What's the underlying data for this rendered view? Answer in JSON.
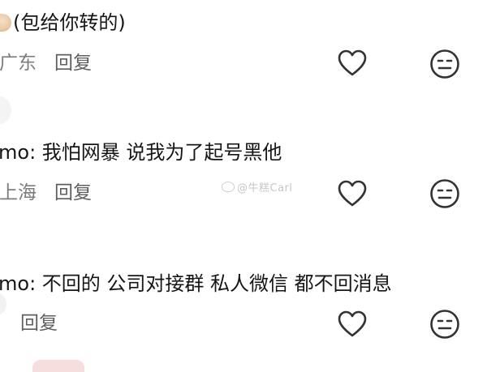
{
  "comments": [
    {
      "text": "(包给你转的)",
      "location": "广东",
      "reply_label": "回复"
    },
    {
      "text": "mo: 我怕网暴 说我为了起号黑他",
      "location": "上海",
      "reply_label": "回复"
    },
    {
      "text": "mo: 不回的 公司对接群 私人微信 都不回消息",
      "location": "",
      "reply_label": "回复"
    }
  ],
  "watermark": "@牛糕Carl",
  "icons": {
    "like": "heart-outline-icon",
    "dislike": "neutral-face-icon"
  },
  "colors": {
    "text": "#161616",
    "meta": "#7d7d7d",
    "icon_stroke": "#333333"
  }
}
